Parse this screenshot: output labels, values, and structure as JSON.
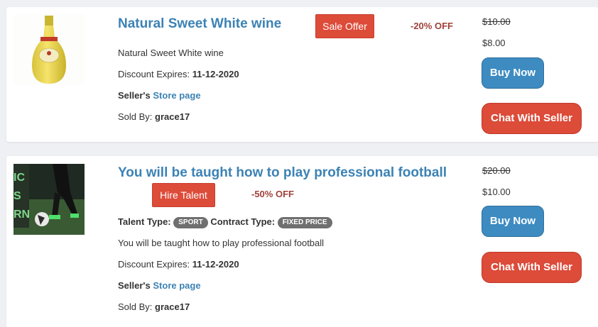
{
  "listings": [
    {
      "image_icon": "wine-bottle-image",
      "title": "Natural Sweet White wine",
      "offer_label": "Sale Offer",
      "discount": "-20% OFF",
      "description": "Natural Sweet White wine",
      "expires_label": "Discount Expires:",
      "expires_value": "11-12-2020",
      "seller_label": "Seller's",
      "store_link": "Store page",
      "sold_by_label": "Sold By:",
      "sold_by_value": "grace17",
      "old_price": "$10.00",
      "new_price": "$8.00",
      "buy_label": "Buy Now",
      "chat_label": "Chat With Seller"
    },
    {
      "image_icon": "football-player-image",
      "title": "You will be taught how to play professional football",
      "offer_label": "Hire Talent",
      "discount": "-50% OFF",
      "talent_type_label": "Talent Type:",
      "talent_type_value": "SPORT",
      "contract_type_label": "Contract Type:",
      "contract_type_value": "FIXED PRICE",
      "description": "You will be taught how to play professional football",
      "expires_label": "Discount Expires:",
      "expires_value": "11-12-2020",
      "seller_label": "Seller's",
      "store_link": "Store page",
      "sold_by_label": "Sold By:",
      "sold_by_value": "grace17",
      "old_price": "$20.00",
      "new_price": "$10.00",
      "buy_label": "Buy Now",
      "chat_label": "Chat With Seller",
      "image_text": [
        "IC",
        "S",
        "RN"
      ]
    }
  ],
  "colors": {
    "accent_blue": "#3c82b4",
    "button_blue": "#3d8bc1",
    "button_red": "#dd4b39",
    "discount_red": "#a0403a"
  }
}
